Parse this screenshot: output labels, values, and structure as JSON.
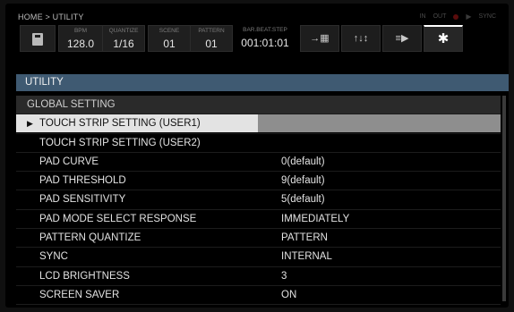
{
  "breadcrumb": "HOME > UTILITY",
  "status": {
    "in_label": "IN",
    "out_label": "OUT",
    "sync_label": "SYNC"
  },
  "toolbar": {
    "bpm": {
      "label": "BPM",
      "value": "128.0"
    },
    "quantize": {
      "label": "QUANTIZE",
      "value": "1/16"
    },
    "scene": {
      "label": "SCENE",
      "value": "01"
    },
    "pattern": {
      "label": "PATTERN",
      "value": "01"
    },
    "position": {
      "label": "BAR.BEAT.STEP",
      "value": "001:01:01"
    },
    "nav_icons": [
      "sequence-icon",
      "mixer-icon",
      "instrument-icon",
      "gear-icon"
    ],
    "nav_glyphs": [
      "→▦",
      "↑↓↕",
      "≡▶",
      "✱"
    ]
  },
  "panel_title": "UTILITY",
  "settings": {
    "group_header": "GLOBAL SETTING",
    "rows": [
      {
        "name": "TOUCH STRIP SETTING (USER1)",
        "value": ""
      },
      {
        "name": "TOUCH STRIP SETTING (USER2)",
        "value": ""
      },
      {
        "name": "PAD CURVE",
        "value": "0(default)"
      },
      {
        "name": "PAD THRESHOLD",
        "value": "9(default)"
      },
      {
        "name": "PAD SENSITIVITY",
        "value": "5(default)"
      },
      {
        "name": "PAD MODE SELECT RESPONSE",
        "value": "IMMEDIATELY"
      },
      {
        "name": "PATTERN QUANTIZE",
        "value": "PATTERN"
      },
      {
        "name": "SYNC",
        "value": "INTERNAL"
      },
      {
        "name": "LCD BRIGHTNESS",
        "value": "3"
      },
      {
        "name": "SCREEN SAVER",
        "value": "ON"
      }
    ],
    "selected_index": 0,
    "cursor_glyph": "▶"
  }
}
